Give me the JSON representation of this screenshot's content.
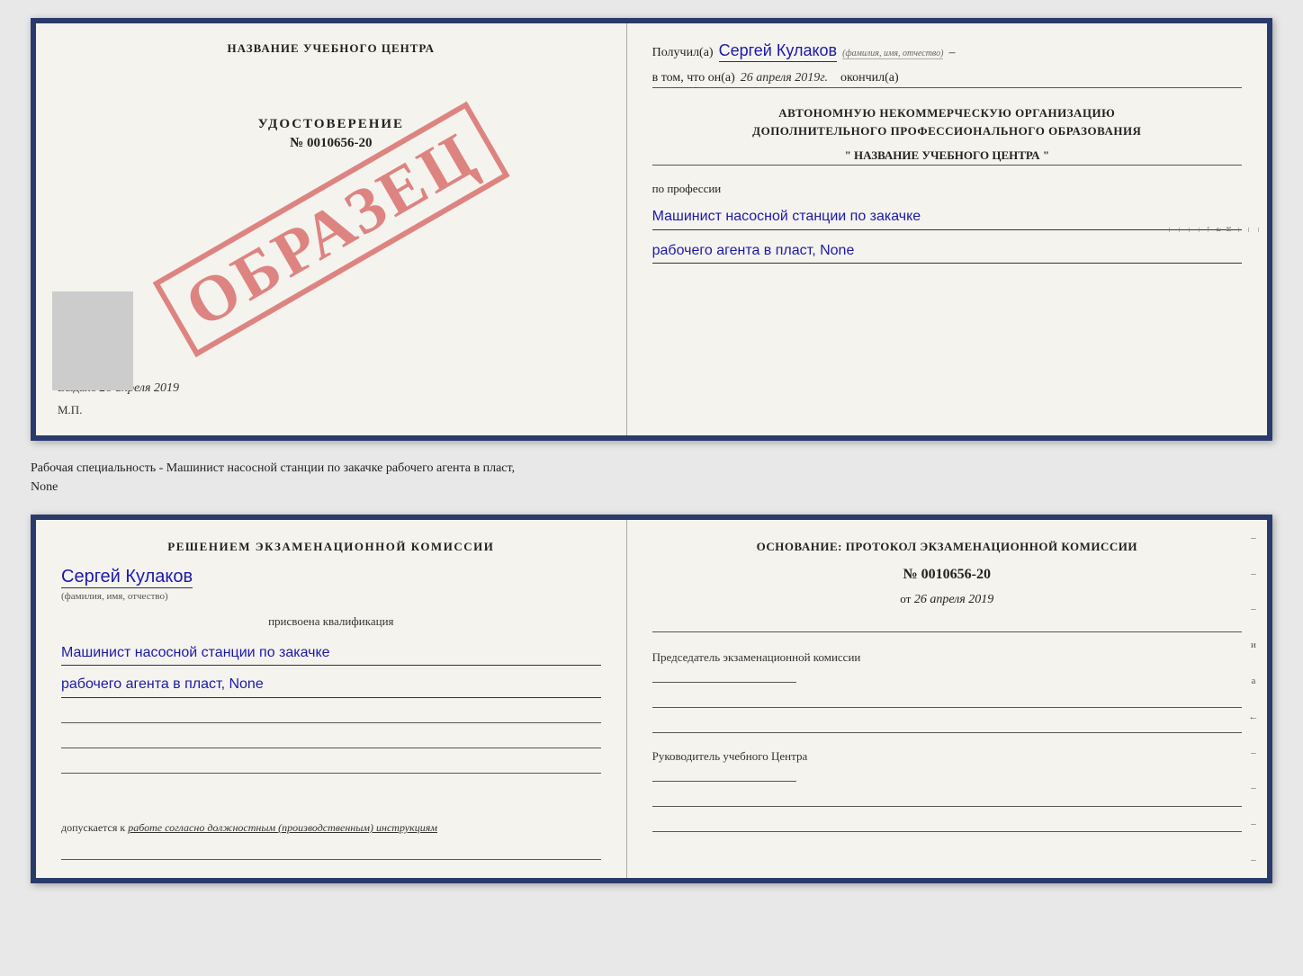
{
  "topDocument": {
    "left": {
      "orgName": "НАЗВАНИЕ УЧЕБНОГО ЦЕНТРА",
      "udostTitle": "УДОСТОВЕРЕНИЕ",
      "udostNumber": "№ 0010656-20",
      "vydanoLabel": "Выдано",
      "vydanoDate": "26 апреля 2019",
      "mpLabel": "М.П.",
      "obrazets": "ОБРАЗЕЦ"
    },
    "right": {
      "poluchilLabel": "Получил(а)",
      "poluchilName": "Сергей Кулаков",
      "familiyaLabel": "(фамилия, имя, отчество)",
      "vtomLabel": "в том, что он(а)",
      "vtomDate": "26 апреля 2019г.",
      "okonchilLabel": "окончил(а)",
      "orgLine1": "АВТОНОМНУЮ НЕКОММЕРЧЕСКУЮ ОРГАНИЗАЦИЮ",
      "orgLine2": "ДОПОЛНИТЕЛЬНОГО ПРОФЕССИОНАЛЬНОГО ОБРАЗОВАНИЯ",
      "orgNameQuoted": "\"  НАЗВАНИЕ УЧЕБНОГО ЦЕНТРА  \"",
      "poProfessiiLabel": "по профессии",
      "profLine1": "Машинист насосной станции по закачке",
      "profLine2": "рабочего агента в пласт, None"
    }
  },
  "betweenCaption": {
    "line1": "Рабочая специальность - Машинист насосной станции по закачке рабочего агента в пласт,",
    "line2": "None"
  },
  "bottomDocument": {
    "left": {
      "reshenieTitle": "Решением экзаменационной комиссии",
      "name": "Сергей Кулаков",
      "familiyaLabel": "(фамилия, имя, отчество)",
      "prisvoenaLabel": "присвоена квалификация",
      "qualLine1": "Машинист насосной станции по закачке",
      "qualLine2": "рабочего агента в пласт, None",
      "dopuskaetsyaLabel": "допускается к",
      "dopuskaetsyaText": "работе согласно должностным (производственным) инструкциям"
    },
    "right": {
      "osnovanieLabelLine1": "Основание: протокол экзаменационной комиссии",
      "protocolNumber": "№ 0010656-20",
      "otLabel": "от",
      "protocolDate": "26 апреля 2019",
      "predsedatelLabel": "Председатель экзаменационной комиссии",
      "rukovoditelLabel": "Руководитель учебного Центра"
    }
  },
  "sideMarks": {
    "marks": [
      "-",
      "-",
      "-",
      "и",
      "а",
      "←",
      "-",
      "-",
      "-",
      "-"
    ]
  }
}
